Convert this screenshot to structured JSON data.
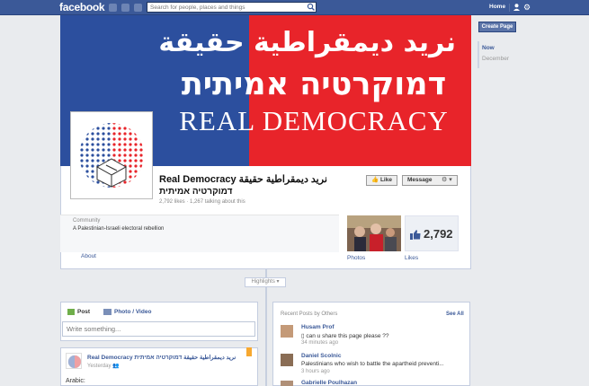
{
  "topbar": {
    "logo": "facebook",
    "search_placeholder": "Search for people, places and things",
    "home": "Home"
  },
  "sidebar": {
    "create_page": "Create Page",
    "timeline": [
      "Now",
      "December"
    ]
  },
  "cover": {
    "arabic": "نريد ديمقراطية حقيقة",
    "hebrew": "דמוקרטיה אמיתית",
    "english": "REAL DEMOCRACY"
  },
  "page": {
    "name_line1": "Real Democracy نريد ديمقراطية حقيقة",
    "name_line2": "דמוקרטיה אמיתית",
    "stats": "2,792 likes · 1,267 talking about this",
    "like_button": "Like",
    "message_button": "Message",
    "category": "Community",
    "about_text": "A Palestinian-Israeli electoral rebellion",
    "about_link": "About",
    "photos_label": "Photos",
    "likes_count": "2,792",
    "likes_label": "Likes"
  },
  "timeline": {
    "highlights": "Highlights ▾",
    "composer": {
      "tab_post": "Post",
      "tab_photo": "Photo / Video",
      "placeholder": "Write something..."
    },
    "post": {
      "author": "Real Democracy نريد ديمقراطية حقيقة דמוקרטיה אמיתית",
      "time": "Yesterday",
      "body": "Arabic:"
    },
    "recent": {
      "title": "Recent Posts by Others",
      "see_all": "See All",
      "items": [
        {
          "name": "Husam Prof",
          "text": "can u share this page please ??",
          "time": "34 minutes ago"
        },
        {
          "name": "Daniel Scolnic",
          "text": "Palestinians who wish to battle the apartheid preventi...",
          "time": "3 hours ago"
        },
        {
          "name": "Gabrielle Poulhazan",
          "text": "",
          "time": ""
        }
      ]
    }
  },
  "colors": {
    "facebook_blue": "#3b5998",
    "cover_blue": "#2c4f9e",
    "cover_red": "#e8242a"
  }
}
